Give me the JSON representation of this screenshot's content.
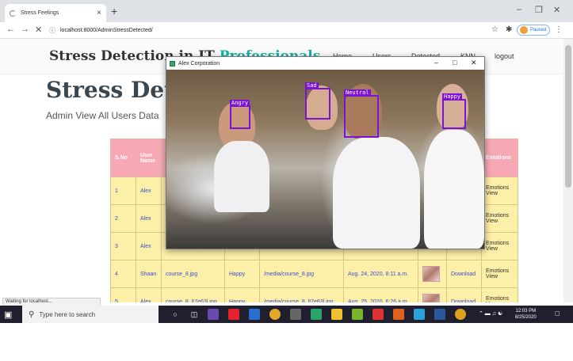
{
  "browser": {
    "tab_title": "Stress Feelings",
    "tab_close": "×",
    "new_tab": "+",
    "url": "localhost:8000/AdminStressDetected/",
    "paused_label": "Paused",
    "status_text": "Waiting for localhost..."
  },
  "site": {
    "brand_main": "Stress Detection in IT ",
    "brand_accent": "Professionals",
    "nav": [
      "Home",
      "Users",
      "Detected",
      "KNN",
      "logout"
    ],
    "page_title": "Stress Dete",
    "page_subtitle": "Admin View All Users Data"
  },
  "table": {
    "headers": [
      "S.No",
      "User Name",
      "Emotions"
    ],
    "rows": [
      {
        "sno": "1",
        "user": "Alex",
        "file": "",
        "emotion": "",
        "path": "",
        "date": "",
        "download": "",
        "view": "Emotions View"
      },
      {
        "sno": "2",
        "user": "Alex",
        "file": "",
        "emotion": "",
        "path": "",
        "date": "",
        "download": "",
        "view": "Emotions View"
      },
      {
        "sno": "3",
        "user": "Alex",
        "file": "",
        "emotion": "",
        "path": "",
        "date": "",
        "download": "",
        "view": "Emotions View"
      },
      {
        "sno": "4",
        "user": "Shaan",
        "file": "course_8.jpg",
        "emotion": "Happy",
        "path": "/media/course_8.jpg",
        "date": "Aug. 24, 2020, 8:11 a.m.",
        "download": "Download",
        "view": "Emotions View"
      },
      {
        "sno": "5",
        "user": "Alex",
        "file": "course_8_lt7e63l.jpg",
        "emotion": "Happy",
        "path": "/media/course_8_lt7e63l.jpg",
        "date": "Aug. 25, 2020, 6:26 a.m.",
        "download": "Download",
        "view": "Emotions View"
      }
    ]
  },
  "overlay": {
    "title": "Alex Corporation",
    "faces": [
      "Angry",
      "Sad",
      "Neutral",
      "Happy"
    ]
  },
  "taskbar": {
    "search_placeholder": "Type here to search",
    "time": "12:03 PM",
    "date": "8/25/2020"
  },
  "colors": {
    "header_bg": "#f7a8b4",
    "row_bg": "#fcefa8",
    "accent": "#10b3a3",
    "bbox": "#7b12d4"
  }
}
